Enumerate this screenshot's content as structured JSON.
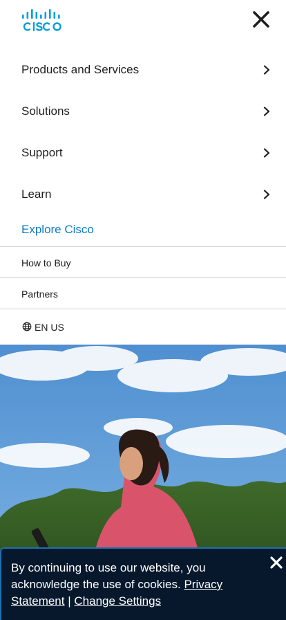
{
  "header": {
    "logo_icon": "cisco-logo",
    "close_icon": "close-icon"
  },
  "menu": {
    "items": [
      {
        "label": "Products and Services",
        "icon": "chevron-right-icon"
      },
      {
        "label": "Solutions",
        "icon": "chevron-right-icon"
      },
      {
        "label": "Support",
        "icon": "chevron-right-icon"
      },
      {
        "label": "Learn",
        "icon": "chevron-right-icon"
      }
    ],
    "explore_label": "Explore Cisco"
  },
  "links": {
    "how_to_buy": "How to Buy",
    "partners": "Partners",
    "language": "EN US",
    "language_icon": "globe-icon"
  },
  "cookie_banner": {
    "text": "By continuing to use our website, you acknowledge the use of cookies.",
    "privacy_link": "Privacy Statement",
    "separator": "|",
    "settings_link": "Change Settings",
    "close_icon": "close-icon"
  },
  "colors": {
    "accent": "#0d7cc4",
    "logo": "#049fd9",
    "banner_bg": "#07182d",
    "banner_border": "#1d6fb0",
    "divider": "#cfcfcf"
  }
}
